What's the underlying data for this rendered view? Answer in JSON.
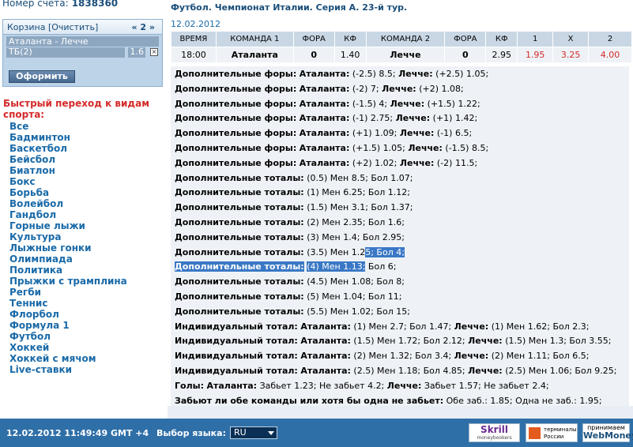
{
  "account": {
    "label": "Номер счёта:",
    "number": "1838360"
  },
  "cart": {
    "title": "Корзина [Очистить]",
    "nav": "« 2 »",
    "item": "Аталанта - Лечче",
    "bet": "ТБ(2)",
    "coef": "1.6",
    "remove_icon": "×",
    "order_button": "Оформить"
  },
  "quick_nav": {
    "title": "Быстрый переход к видам спорта:",
    "sports": [
      "Все",
      "Бадминтон",
      "Баскетбол",
      "Бейсбол",
      "Биатлон",
      "Бокс",
      "Борьба",
      "Волейбол",
      "Гандбол",
      "Горные лыжи",
      "Культура",
      "Лыжные гонки",
      "Олимпиада",
      "Политика",
      "Прыжки с трамплина",
      "Регби",
      "Теннис",
      "Флорбол",
      "Формула 1",
      "Футбол",
      "Хоккей",
      "Хоккей с мячом",
      "Live-ставки"
    ]
  },
  "event": {
    "title": "Футбол. Чемпионат Италии. Серия А. 23-й тур.",
    "date": "12.02.2012",
    "headers": [
      "ВРЕМЯ",
      "КОМАНДА 1",
      "ФОРА",
      "КФ",
      "КОМАНДА 2",
      "ФОРА",
      "КФ",
      "1",
      "X",
      "2"
    ],
    "row": [
      "18:00",
      "Аталанта",
      "0",
      "1.40",
      "Лечче",
      "0",
      "2.95",
      "1.95",
      "3.25",
      "4.00"
    ]
  },
  "lines": [
    {
      "label": "Дополнительные форы:",
      "t1": "Аталанта:",
      "v1": "(-2.5) 8.5;",
      "t2": "Лечче:",
      "v2": "(+2.5) 1.05;"
    },
    {
      "label": "Дополнительные форы:",
      "t1": "Аталанта:",
      "v1": "(-2) 7;",
      "t2": "Лечче:",
      "v2": "(+2) 1.08;"
    },
    {
      "label": "Дополнительные форы:",
      "t1": "Аталанта:",
      "v1": "(-1.5) 4;",
      "t2": "Лечче:",
      "v2": "(+1.5) 1.22;"
    },
    {
      "label": "Дополнительные форы:",
      "t1": "Аталанта:",
      "v1": "(-1) 2.75;",
      "t2": "Лечче:",
      "v2": "(+1) 1.42;"
    },
    {
      "label": "Дополнительные форы:",
      "t1": "Аталанта:",
      "v1": "(+1) 1.09;",
      "t2": "Лечче:",
      "v2": "(-1) 6.5;"
    },
    {
      "label": "Дополнительные форы:",
      "t1": "Аталанта:",
      "v1": "(+1.5) 1.05;",
      "t2": "Лечче:",
      "v2": "(-1.5) 8.5;"
    },
    {
      "label": "Дополнительные форы:",
      "t1": "Аталанта:",
      "v1": "(+2) 1.02;",
      "t2": "Лечче:",
      "v2": "(-2) 11.5;"
    },
    {
      "label": "Дополнительные тоталы:",
      "v1": "(0.5) Мен 8.5; Бол 1.07;"
    },
    {
      "label": "Дополнительные тоталы:",
      "v1": "(1) Мен 6.25; Бол 1.12;"
    },
    {
      "label": "Дополнительные тоталы:",
      "v1": "(1.5) Мен 3.1; Бол 1.37;"
    },
    {
      "label": "Дополнительные тоталы:",
      "v1": "(2) Мен 2.35; Бол 1.6;"
    },
    {
      "label": "Дополнительные тоталы:",
      "v1": "(3) Мен 1.4; Бол 2.95;"
    },
    {
      "label": "Дополнительные тоталы:",
      "v1": "(3.5) Мен 1.2",
      "hl1": "5; Бол 4;"
    },
    {
      "label": "Дополнительные тоталы:",
      "v1": "(4) Мен 1.13;",
      "v2": " Бол 6;",
      "highlight": true
    },
    {
      "label": "Дополнительные тоталы:",
      "v1": "(4.5) Мен 1.08; Бол 8;"
    },
    {
      "label": "Дополнительные тоталы:",
      "v1": "(5) Мен 1.04; Бол 11;"
    },
    {
      "label": "Дополнительные тоталы:",
      "v1": "(5.5) Мен 1.02; Бол 15;"
    },
    {
      "label": "Индивидуальный тотал:",
      "t1": "Аталанта:",
      "v1": "(1) Мен 2.7; Бол 1.47;",
      "t2": "Лечче:",
      "v2": "(1) Мен 1.62; Бол 2.3;"
    },
    {
      "label": "Индивидуальный тотал:",
      "t1": "Аталанта:",
      "v1": "(1.5) Мен 1.72; Бол 2.12;",
      "t2": "Лечче:",
      "v2": "(1.5) Мен 1.3; Бол 3.55;"
    },
    {
      "label": "Индивидуальный тотал:",
      "t1": "Аталанта:",
      "v1": "(2) Мен 1.32; Бол 3.4;",
      "t2": "Лечче:",
      "v2": "(2) Мен 1.11; Бол 6.5;"
    },
    {
      "label": "Индивидуальный тотал:",
      "t1": "Аталанта:",
      "v1": "(2.5) Мен 1.18; Бол 4.85;",
      "t2": "Лечче:",
      "v2": "(2.5) Мен 1.06; Бол 9.25;"
    },
    {
      "label": "Голы:",
      "t1": "Аталанта:",
      "v1": "Забьет 1.23; Не забьет 4.2;",
      "t2": "Лечче:",
      "v2": "Забьет 1.57; Не забьет 2.4;"
    },
    {
      "label": "Забьют ли обе команды или хотя бы одна не забьет:",
      "v1": "Обе заб.: 1.85; Одна не заб.: 1.95;"
    }
  ],
  "footer": {
    "datetime": "12.02.2012  11:49:49  GMT +4",
    "lang_label": "Выбор языка:",
    "lang_value": "RU",
    "skrill": "Skrill",
    "skrill_sub": "moneybookers",
    "terminals": "терминалы России",
    "wm_top": "принимаем",
    "wm_bottom": "WebMoney"
  }
}
